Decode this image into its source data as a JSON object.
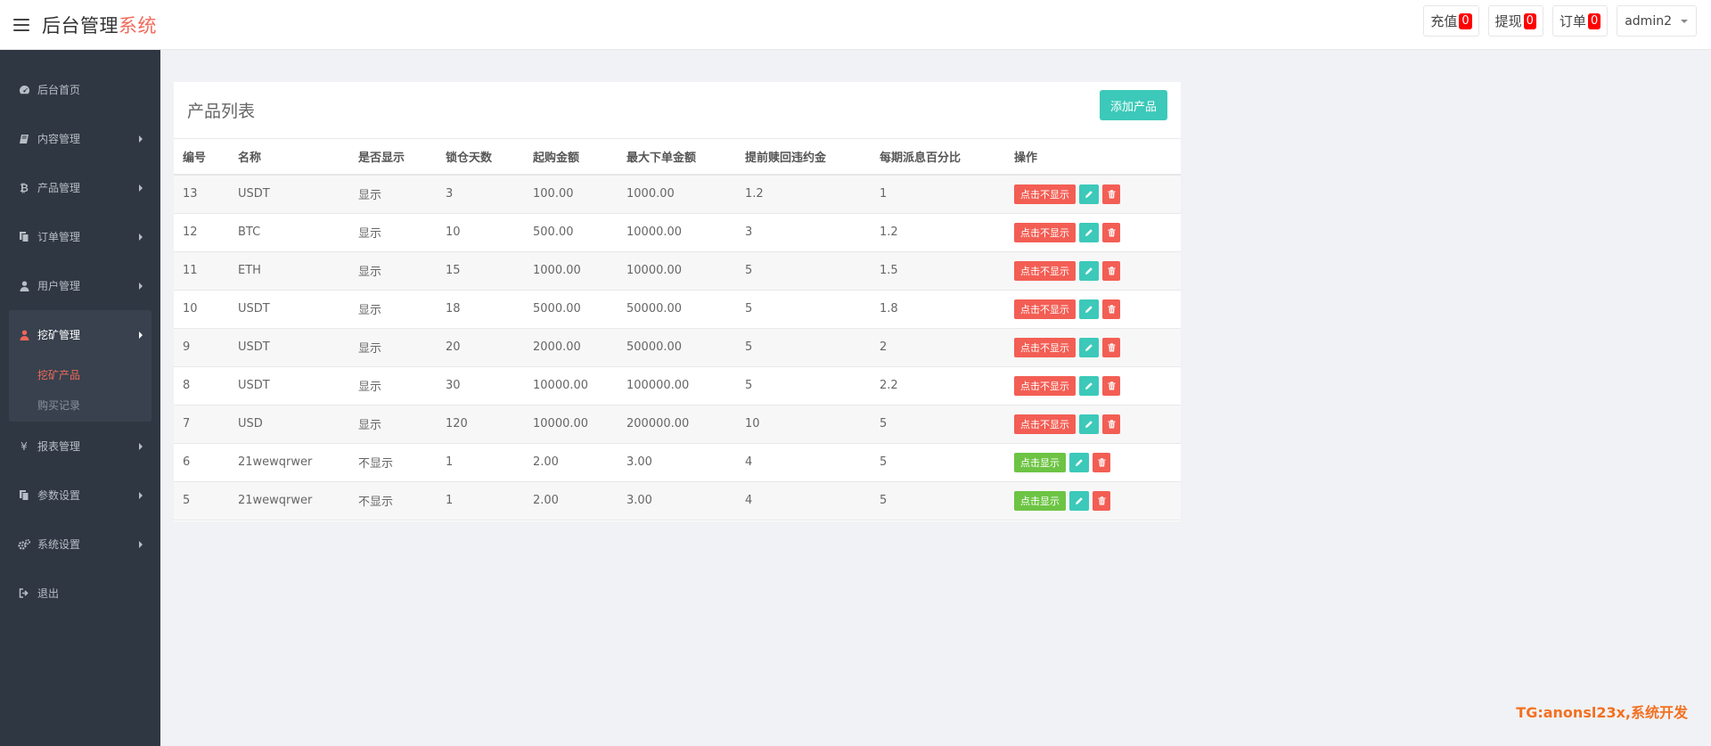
{
  "header": {
    "brand_main": "后台管理",
    "brand_accent": "系统",
    "recharge_label": "充值",
    "recharge_count": "0",
    "withdraw_label": "提现",
    "withdraw_count": "0",
    "order_label": "订单",
    "order_count": "0",
    "user_label": "admin2"
  },
  "sidebar": {
    "items": [
      {
        "label": "后台首页",
        "icon": "dashboard-icon"
      },
      {
        "label": "内容管理",
        "icon": "book-icon"
      },
      {
        "label": "产品管理",
        "icon": "bitcoin-icon"
      },
      {
        "label": "订单管理",
        "icon": "copy-icon"
      },
      {
        "label": "用户管理",
        "icon": "user-icon"
      }
    ],
    "mining": {
      "label": "挖矿管理",
      "icon": "user-tie-icon",
      "sub": [
        "挖矿产品",
        "购买记录"
      ]
    },
    "items_after": [
      {
        "label": "报表管理",
        "icon": "yen-icon"
      },
      {
        "label": "参数设置",
        "icon": "copy-icon"
      },
      {
        "label": "系统设置",
        "icon": "gears-icon"
      },
      {
        "label": "退出",
        "icon": "sign-out-icon"
      }
    ]
  },
  "panel": {
    "title": "产品列表",
    "add_button": "添加产品"
  },
  "table": {
    "headers": [
      "编号",
      "名称",
      "是否显示",
      "锁仓天数",
      "起购金额",
      "最大下单金额",
      "提前赎回违约金",
      "每期派息百分比",
      "操作"
    ],
    "rows": [
      [
        "13",
        "USDT",
        "显示",
        "3",
        "100.00",
        "1000.00",
        "1.2",
        "1",
        "点击不显示"
      ],
      [
        "12",
        "BTC",
        "显示",
        "10",
        "500.00",
        "10000.00",
        "3",
        "1.2",
        "点击不显示"
      ],
      [
        "11",
        "ETH",
        "显示",
        "15",
        "1000.00",
        "10000.00",
        "5",
        "1.5",
        "点击不显示"
      ],
      [
        "10",
        "USDT",
        "显示",
        "18",
        "5000.00",
        "50000.00",
        "5",
        "1.8",
        "点击不显示"
      ],
      [
        "9",
        "USDT",
        "显示",
        "20",
        "2000.00",
        "50000.00",
        "5",
        "2",
        "点击不显示"
      ],
      [
        "8",
        "USDT",
        "显示",
        "30",
        "10000.00",
        "100000.00",
        "5",
        "2.2",
        "点击不显示"
      ],
      [
        "7",
        "USD",
        "显示",
        "120",
        "10000.00",
        "200000.00",
        "10",
        "5",
        "点击不显示"
      ],
      [
        "6",
        "21wewqrwer",
        "不显示",
        "1",
        "2.00",
        "3.00",
        "4",
        "5",
        "点击显示"
      ],
      [
        "5",
        "21wewqrwer",
        "不显示",
        "1",
        "2.00",
        "3.00",
        "4",
        "5",
        "点击显示"
      ]
    ]
  },
  "watermark": "TG:anonsl23x,系统开发",
  "colors": {
    "accent": "#f06a5b",
    "teal": "#3cc9b9",
    "red": "#f35e54",
    "green": "#6dc444",
    "sidebar_bg": "#2f3742",
    "watermark": "#f37021"
  }
}
